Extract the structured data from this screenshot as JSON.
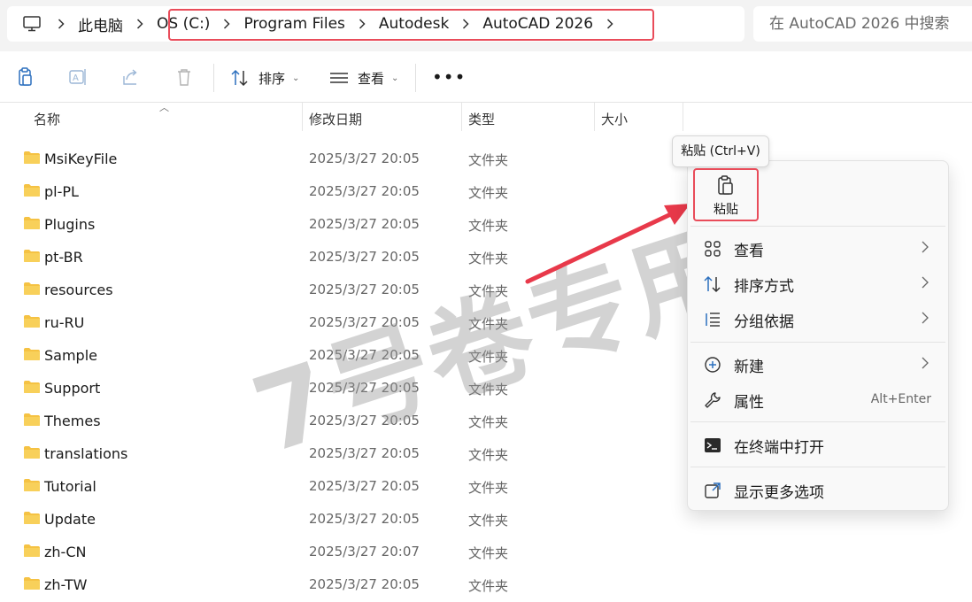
{
  "address": {
    "root": "此电脑",
    "crumbs": [
      "OS (C:)",
      "Program Files",
      "Autodesk",
      "AutoCAD 2026"
    ],
    "search_placeholder": "在 AutoCAD 2026 中搜索"
  },
  "toolbar": {
    "sort_label": "排序",
    "view_label": "查看",
    "more_label": "•••"
  },
  "columns": {
    "name": "名称",
    "modified": "修改日期",
    "type": "类型",
    "size": "大小"
  },
  "rows": [
    {
      "name": "MsiKeyFile",
      "modified": "2025/3/27 20:05",
      "type": "文件夹"
    },
    {
      "name": "pl-PL",
      "modified": "2025/3/27 20:05",
      "type": "文件夹"
    },
    {
      "name": "Plugins",
      "modified": "2025/3/27 20:05",
      "type": "文件夹"
    },
    {
      "name": "pt-BR",
      "modified": "2025/3/27 20:05",
      "type": "文件夹"
    },
    {
      "name": "resources",
      "modified": "2025/3/27 20:05",
      "type": "文件夹"
    },
    {
      "name": "ru-RU",
      "modified": "2025/3/27 20:05",
      "type": "文件夹"
    },
    {
      "name": "Sample",
      "modified": "2025/3/27 20:05",
      "type": "文件夹"
    },
    {
      "name": "Support",
      "modified": "2025/3/27 20:05",
      "type": "文件夹"
    },
    {
      "name": "Themes",
      "modified": "2025/3/27 20:05",
      "type": "文件夹"
    },
    {
      "name": "translations",
      "modified": "2025/3/27 20:05",
      "type": "文件夹"
    },
    {
      "name": "Tutorial",
      "modified": "2025/3/27 20:05",
      "type": "文件夹"
    },
    {
      "name": "Update",
      "modified": "2025/3/27 20:05",
      "type": "文件夹"
    },
    {
      "name": "zh-CN",
      "modified": "2025/3/27 20:07",
      "type": "文件夹"
    },
    {
      "name": "zh-TW",
      "modified": "2025/3/27 20:05",
      "type": "文件夹"
    }
  ],
  "watermark": "7号卷专用",
  "context_menu": {
    "tooltip": "粘贴 (Ctrl+V)",
    "paste_label": "粘贴",
    "items": [
      {
        "label": "查看",
        "icon": "grid-view-icon",
        "submenu": true
      },
      {
        "label": "排序方式",
        "icon": "sort-icon",
        "submenu": true
      },
      {
        "label": "分组依据",
        "icon": "group-icon",
        "submenu": true
      },
      {
        "label": "新建",
        "icon": "new-plus-icon",
        "submenu": true
      },
      {
        "label": "属性",
        "icon": "wrench-icon",
        "shortcut": "Alt+Enter"
      },
      {
        "label": "在终端中打开",
        "icon": "terminal-icon"
      },
      {
        "label": "显示更多选项",
        "icon": "more-options-icon"
      }
    ]
  },
  "colors": {
    "highlight_border": "#e94c5a",
    "folder": "#f5c243",
    "arrow": "#e8394a"
  }
}
